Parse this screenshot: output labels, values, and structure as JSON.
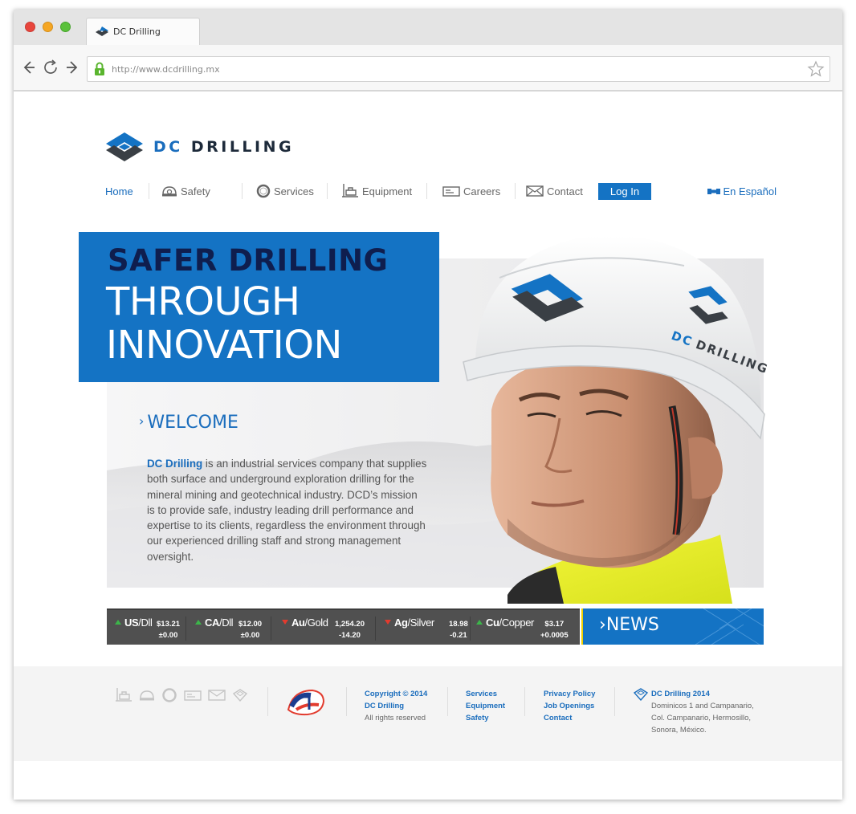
{
  "browser": {
    "tab_title": "DC Drilling",
    "url": "http://www.dcdrilling.mx",
    "traffic_lights": [
      "#e8453c",
      "#f5a623",
      "#5ac13b"
    ]
  },
  "brand": {
    "name_dc": "DC",
    "name_rest": "DRILLING",
    "accent": "#1473c4",
    "navy": "#0f1e4e"
  },
  "nav": {
    "home": "Home",
    "safety": "Safety",
    "services": "Services",
    "equipment": "Equipment",
    "careers": "Careers",
    "contact": "Contact",
    "login": "Log In",
    "language": "En Español"
  },
  "hero": {
    "headline_1": "SAFER DRILLING",
    "headline_2": "THROUGH",
    "headline_3": "INNOVATION",
    "welcome": "WELCOME",
    "intro_brand": "DC Drilling",
    "intro_text": " is an industrial services company that supplies both surface and underground exploration drilling for the mineral mining and geotechnical industry. DCD’s mission is to provide safe, industry leading drill performance and expertise to its clients, regardless the environment through our experienced drilling staff and strong management oversight.",
    "helmet_text_dc": "DC",
    "helmet_text_rest": "DRILLING"
  },
  "ticker": [
    {
      "sym": "US",
      "unit": "/Dll",
      "price": "$13.21",
      "change": "±0.00",
      "trend": "up"
    },
    {
      "sym": "CA",
      "unit": "/Dll",
      "price": "$12.00",
      "change": "±0.00",
      "trend": "up"
    },
    {
      "sym": "Au",
      "unit": "/Gold",
      "price": "1,254.20",
      "change": "-14.20",
      "trend": "down"
    },
    {
      "sym": "Ag",
      "unit": "/Silver",
      "price": "18.98",
      "change": "-0.21",
      "trend": "down"
    },
    {
      "sym": "Cu",
      "unit": "/Copper",
      "price": "$3.17",
      "change": "+0.0005",
      "trend": "up"
    }
  ],
  "news": {
    "chevron": "›",
    "label": "NEWS"
  },
  "footer": {
    "copyright_1": "Copyright © 2014",
    "copyright_2": "DC Drilling",
    "copyright_3": "All rights reserved",
    "link_services": "Services",
    "link_equipment": "Equipment",
    "link_safety": "Safety",
    "link_privacy": "Privacy Policy",
    "link_jobs": "Job Openings",
    "link_contact": "Contact",
    "company": "DC Drilling 2014",
    "address_1": "Dominicos 1 and Campanario,",
    "address_2": "Col. Campanario, Hermosillo,",
    "address_3": "Sonora, México."
  }
}
